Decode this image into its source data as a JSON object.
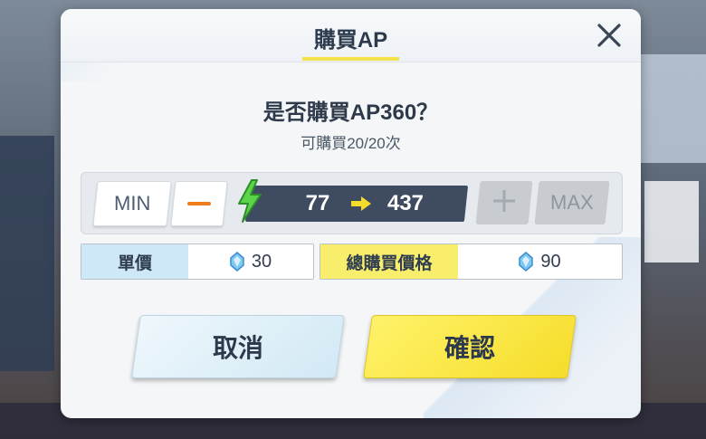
{
  "dialog": {
    "title": "購買AP",
    "question": "是否購買AP360？",
    "remaining": "可購買20/20次"
  },
  "stepper": {
    "min_label": "MIN",
    "max_label": "MAX",
    "ap_current": "77",
    "ap_after": "437"
  },
  "price": {
    "unit_label": "單價",
    "unit_value": "30",
    "total_label": "總購買價格",
    "total_value": "90"
  },
  "actions": {
    "cancel_label": "取消",
    "confirm_label": "確認"
  },
  "colors": {
    "accent_yellow": "#f6dd2a",
    "ap_bar": "#3e4b60",
    "minus_orange": "#f07d1c",
    "unit_label_bg": "#cfe8f7",
    "total_label_bg": "#f8ee6c"
  },
  "icons": [
    "close-icon",
    "ap-lightning-icon",
    "arrow-right-icon",
    "minus-icon",
    "plus-icon",
    "gem-icon"
  ]
}
